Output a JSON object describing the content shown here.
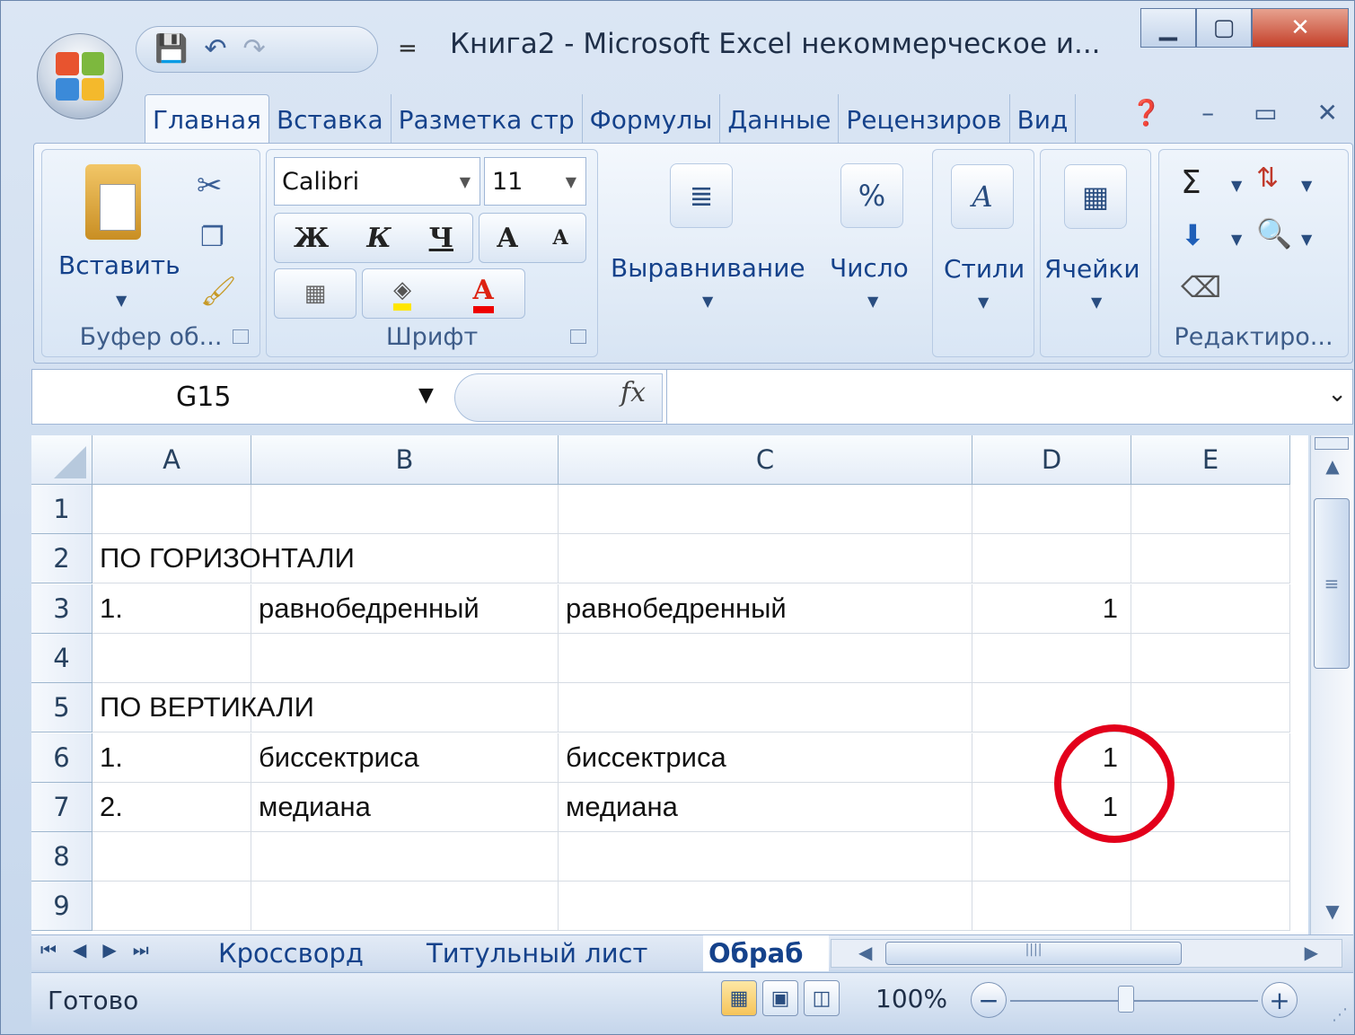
{
  "window": {
    "title": "Книга2 - Microsoft Excel некоммерческое и..."
  },
  "qat": {
    "save": "💾",
    "undo": "↶",
    "redo": "↷",
    "more": "="
  },
  "tabs": [
    "Главная",
    "Вставка",
    "Разметка стр",
    "Формулы",
    "Данные",
    "Рецензиров",
    "Вид"
  ],
  "ribbon": {
    "clipboard": {
      "paste_label": "Вставить",
      "group_label": "Буфер об..."
    },
    "font": {
      "name": "Calibri",
      "size": "11",
      "bold": "Ж",
      "italic": "К",
      "underline": "Ч",
      "grow": "A",
      "shrink": "A",
      "font_color_letter": "A",
      "group_label": "Шрифт"
    },
    "alignment": {
      "label": "Выравнивание"
    },
    "number": {
      "label": "Число",
      "icon_text": "%"
    },
    "styles": {
      "label": "Стили",
      "icon_text": "A"
    },
    "cells": {
      "label": "Ячейки"
    },
    "editing": {
      "group_label": "Редактиро...",
      "sum_icon": "Σ"
    }
  },
  "formula_bar": {
    "name_box": "G15",
    "fx": "fx",
    "formula": ""
  },
  "columns": [
    "A",
    "B",
    "C",
    "D",
    "E"
  ],
  "rows": [
    {
      "n": "1",
      "A": "",
      "B": "",
      "C": "",
      "D": ""
    },
    {
      "n": "2",
      "A": "ПО ГОРИЗОНТАЛИ",
      "B": "",
      "C": "",
      "D": ""
    },
    {
      "n": "3",
      "A": "1.",
      "B": "равнобедренный",
      "C": "равнобедренный",
      "D": "1"
    },
    {
      "n": "4",
      "A": "",
      "B": "",
      "C": "",
      "D": ""
    },
    {
      "n": "5",
      "A": "ПО ВЕРТИКАЛИ",
      "B": "",
      "C": "",
      "D": ""
    },
    {
      "n": "6",
      "A": "1.",
      "B": "биссектриса",
      "C": "биссектриса",
      "D": "1"
    },
    {
      "n": "7",
      "A": "2.",
      "B": "медиана",
      "C": "медиана",
      "D": "1"
    },
    {
      "n": "8",
      "A": "",
      "B": "",
      "C": "",
      "D": ""
    },
    {
      "n": "9",
      "A": "",
      "B": "",
      "C": "",
      "D": ""
    }
  ],
  "sheets": [
    "Кроссворд",
    "Титульный лист",
    "Обраб"
  ],
  "status": {
    "text": "Готово",
    "zoom": "100%"
  },
  "colors": {
    "annotation": "#e3001b",
    "accent": "#15428b"
  }
}
